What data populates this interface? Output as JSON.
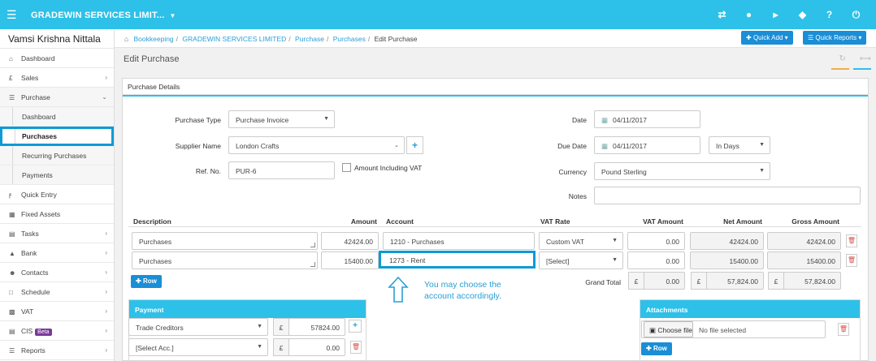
{
  "topbar": {
    "company": "GRADEWIN SERVICES LIMIT...",
    "icons": [
      "exchange-icon",
      "globe-icon",
      "megaphone-icon",
      "tag-icon",
      "help-icon",
      "power-icon"
    ]
  },
  "sidebar": {
    "user": "Vamsi Krishna Nittala",
    "items": {
      "dashboard": "Dashboard",
      "sales": "Sales",
      "purchase": "Purchase",
      "purchase_dashboard": "Dashboard",
      "purchases": "Purchases",
      "recurring": "Recurring Purchases",
      "payments": "Payments",
      "quick_entry": "Quick Entry",
      "fixed_assets": "Fixed Assets",
      "tasks": "Tasks",
      "bank": "Bank",
      "contacts": "Contacts",
      "schedule": "Schedule",
      "vat": "VAT",
      "cis": "CIS",
      "cis_badge": "Beta",
      "reports": "Reports"
    }
  },
  "breadcrumb": {
    "b1": "Bookkeeping",
    "b2": "GRADEWIN SERVICES LIMITED",
    "b3": "Purchase",
    "b4": "Purchases",
    "current": "Edit Purchase"
  },
  "header": {
    "quick_add": "Quick Add",
    "quick_reports": "Quick Reports",
    "page_title": "Edit Purchase"
  },
  "panel": {
    "title": "Purchase Details"
  },
  "form": {
    "purchase_type_label": "Purchase Type",
    "purchase_type": "Purchase Invoice",
    "supplier_label": "Supplier Name",
    "supplier": "London Crafts",
    "ref_label": "Ref. No.",
    "ref": "PUR-6",
    "amount_incl_vat": "Amount Including VAT",
    "date_label": "Date",
    "date": "04/11/2017",
    "due_label": "Due Date",
    "due_date": "04/11/2017",
    "due_unit": "In Days",
    "currency_label": "Currency",
    "currency": "Pound Sterling",
    "notes_label": "Notes"
  },
  "table": {
    "headers": {
      "description": "Description",
      "amount": "Amount",
      "account": "Account",
      "vat_rate": "VAT Rate",
      "vat_amount": "VAT Amount",
      "net_amount": "Net Amount",
      "gross_amount": "Gross Amount"
    },
    "rows": [
      {
        "description": "Purchases",
        "amount": "42424.00",
        "account": "1210 - Purchases",
        "vat_rate": "Custom VAT",
        "vat_amount": "0.00",
        "net": "42424.00",
        "gross": "42424.00"
      },
      {
        "description": "Purchases",
        "amount": "15400.00",
        "account": "1273 - Rent",
        "vat_rate": "[Select]",
        "vat_amount": "0.00",
        "net": "15400.00",
        "gross": "15400.00"
      }
    ],
    "add_row": "Row",
    "grand_total_label": "Grand Total",
    "currency_symbol": "£",
    "grand_vat": "0.00",
    "grand_net": "57,824.00",
    "grand_gross": "57,824.00"
  },
  "annotation": {
    "line1": "You may choose the",
    "line2": "account accordingly."
  },
  "payment": {
    "title": "Payment",
    "acc1": "Trade Creditors",
    "amt1": "57824.00",
    "acc2": "[Select Acc.]",
    "amt2": "0.00"
  },
  "attachments": {
    "title": "Attachments",
    "choose": "Choose file",
    "no_file": "No file selected",
    "add_row": "Row"
  },
  "colors": {
    "brand": "#2dc0e8",
    "button": "#1a8ed6",
    "highlight": "#0e9ad6",
    "danger": "#d9534f"
  }
}
